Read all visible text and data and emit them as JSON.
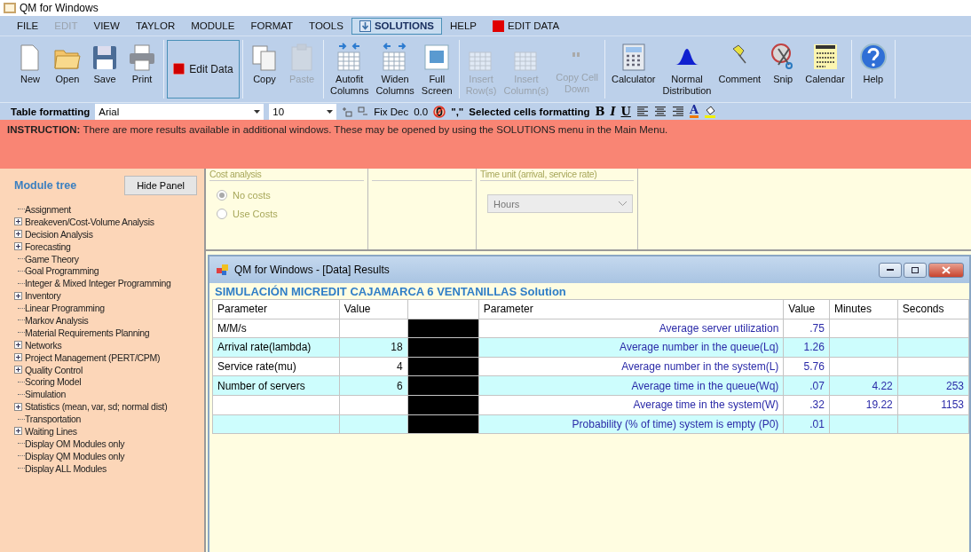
{
  "window": {
    "title": "QM for Windows"
  },
  "menu": [
    {
      "label": "FILE",
      "selected": false,
      "disabled": false
    },
    {
      "label": "EDIT",
      "selected": false,
      "disabled": true
    },
    {
      "label": "VIEW",
      "selected": false,
      "disabled": false
    },
    {
      "label": "TAYLOR",
      "selected": false,
      "disabled": false
    },
    {
      "label": "MODULE",
      "selected": false,
      "disabled": false
    },
    {
      "label": "FORMAT",
      "selected": false,
      "disabled": false
    },
    {
      "label": "TOOLS",
      "selected": false,
      "disabled": false
    },
    {
      "label": "SOLUTIONS",
      "selected": true,
      "disabled": false
    },
    {
      "label": "HELP",
      "selected": false,
      "disabled": false
    },
    {
      "label": "EDIT DATA",
      "selected": false,
      "disabled": false
    }
  ],
  "toolbar": [
    {
      "buttons": [
        {
          "lines": [
            "New"
          ],
          "disabled": false
        },
        {
          "lines": [
            "Open"
          ],
          "disabled": false
        },
        {
          "lines": [
            "Save"
          ],
          "disabled": false
        },
        {
          "lines": [
            "Print"
          ],
          "disabled": false
        }
      ]
    },
    {
      "buttons": [
        {
          "lines": [
            "Edit Data"
          ],
          "disabled": false
        }
      ]
    },
    {
      "buttons": [
        {
          "lines": [
            "Copy"
          ],
          "disabled": false
        },
        {
          "lines": [
            "Paste"
          ],
          "disabled": true
        }
      ]
    },
    {
      "buttons": [
        {
          "lines": [
            "Autofit",
            "Columns"
          ],
          "disabled": false
        },
        {
          "lines": [
            "Widen",
            "Columns"
          ],
          "disabled": false
        },
        {
          "lines": [
            "Full",
            "Screen"
          ],
          "disabled": false
        }
      ]
    },
    {
      "buttons": [
        {
          "lines": [
            "Insert",
            "Row(s)"
          ],
          "disabled": true
        },
        {
          "lines": [
            "Insert",
            "Column(s)"
          ],
          "disabled": true
        },
        {
          "lines": [
            "Copy Cell",
            "Down"
          ],
          "disabled": true
        }
      ]
    },
    {
      "buttons": [
        {
          "lines": [
            "Calculator"
          ],
          "disabled": false
        },
        {
          "lines": [
            "Normal",
            "Distribution"
          ],
          "disabled": false
        },
        {
          "lines": [
            "Comment"
          ],
          "disabled": false
        },
        {
          "lines": [
            "Snip"
          ],
          "disabled": false
        },
        {
          "lines": [
            "Calendar"
          ],
          "disabled": false
        }
      ]
    },
    {
      "buttons": [
        {
          "lines": [
            "Help"
          ],
          "disabled": false
        }
      ]
    }
  ],
  "format_bar": {
    "label": "Table formatting",
    "font": "Arial",
    "size": "10",
    "fix_dec": "Fix Dec",
    "decimal": "0.0",
    "comma": "\",\"",
    "selected_label": "Selected cells formatting",
    "bold": "B",
    "italic": "I",
    "underline": "U",
    "font_color": "A"
  },
  "instruction": {
    "label": "INSTRUCTION:",
    "text": "There are more results available in additional windows. These may be opened by using the SOLUTIONS menu in the Main Menu."
  },
  "sidebar": {
    "title": "Module tree",
    "hide_button": "Hide Panel",
    "items": [
      {
        "label": "Assignment",
        "kind": "leaf"
      },
      {
        "label": "Breakeven/Cost-Volume Analysis",
        "kind": "folder"
      },
      {
        "label": "Decision Analysis",
        "kind": "folder"
      },
      {
        "label": "Forecasting",
        "kind": "folder"
      },
      {
        "label": "Game Theory",
        "kind": "leaf"
      },
      {
        "label": "Goal Programming",
        "kind": "leaf"
      },
      {
        "label": "Integer & Mixed Integer Programming",
        "kind": "leaf"
      },
      {
        "label": "Inventory",
        "kind": "folder"
      },
      {
        "label": "Linear Programming",
        "kind": "leaf"
      },
      {
        "label": "Markov Analysis",
        "kind": "leaf"
      },
      {
        "label": "Material Requirements Planning",
        "kind": "leaf"
      },
      {
        "label": "Networks",
        "kind": "folder"
      },
      {
        "label": "Project Management (PERT/CPM)",
        "kind": "folder"
      },
      {
        "label": "Quality Control",
        "kind": "folder"
      },
      {
        "label": "Scoring Model",
        "kind": "leaf"
      },
      {
        "label": "Simulation",
        "kind": "leaf"
      },
      {
        "label": "Statistics (mean, var, sd; normal dist)",
        "kind": "folder"
      },
      {
        "label": "Transportation",
        "kind": "leaf"
      },
      {
        "label": "Waiting Lines",
        "kind": "folder"
      },
      {
        "label": "Display OM Modules only",
        "kind": "leaf"
      },
      {
        "label": "Display QM Modules only",
        "kind": "leaf"
      },
      {
        "label": "Display ALL Modules",
        "kind": "leaf"
      }
    ]
  },
  "cost_analysis": {
    "title": "Cost analysis",
    "options": [
      {
        "label": "No costs",
        "selected": true
      },
      {
        "label": "Use Costs",
        "selected": false
      }
    ]
  },
  "time_unit": {
    "title": "Time unit (arrival, service rate)",
    "value": "Hours"
  },
  "results": {
    "title": "QM for Windows - [Data] Results",
    "heading": "SIMULACIÓN MICREDIT CAJAMARCA 6 VENTANILLAS Solution",
    "columns": [
      "Parameter",
      "Value",
      "",
      "Parameter",
      "Value",
      "Minutes",
      "Seconds"
    ],
    "rows": [
      [
        "M/M/s",
        "",
        "",
        "Average server utilization",
        ".75",
        "",
        ""
      ],
      [
        "Arrival rate(lambda)",
        "18",
        "",
        "Average number in the queue(Lq)",
        "1.26",
        "",
        ""
      ],
      [
        "Service rate(mu)",
        "4",
        "",
        "Average number in the system(L)",
        "5.76",
        "",
        ""
      ],
      [
        "Number of servers",
        "6",
        "",
        "Average time in the queue(Wq)",
        ".07",
        "4.22",
        "253"
      ],
      [
        "",
        "",
        "",
        "Average time in the system(W)",
        ".32",
        "19.22",
        "1153"
      ],
      [
        "",
        "",
        "",
        "Probability (% of time) system is empty (P0)",
        ".01",
        "",
        ""
      ]
    ]
  }
}
